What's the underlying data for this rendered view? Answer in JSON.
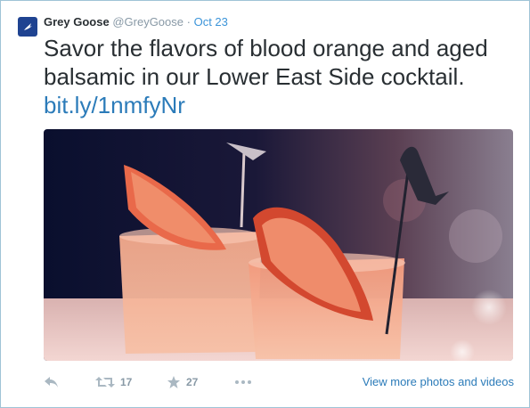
{
  "tweet": {
    "author_name": "Grey Goose",
    "author_handle": "@GreyGoose",
    "separator": "·",
    "date": "Oct 23",
    "text": "Savor the flavors of blood orange and aged balsamic in our Lower East Side cocktail.",
    "link": "bit.ly/1nmfyNr",
    "avatar_icon": "goose-logo-icon",
    "media_subject": "two blood orange cocktails with goose-shaped stirrers"
  },
  "actions": {
    "reply_icon": "reply-icon",
    "retweet_icon": "retweet-icon",
    "retweet_count": "17",
    "favorite_icon": "star-icon",
    "favorite_count": "27",
    "more_icon": "more-dots-icon",
    "view_more_label": "View more photos and videos"
  },
  "colors": {
    "link": "#2b7bb9",
    "avatar_bg": "#1f4391",
    "border": "#9fc3d6",
    "muted": "#8899a6"
  }
}
